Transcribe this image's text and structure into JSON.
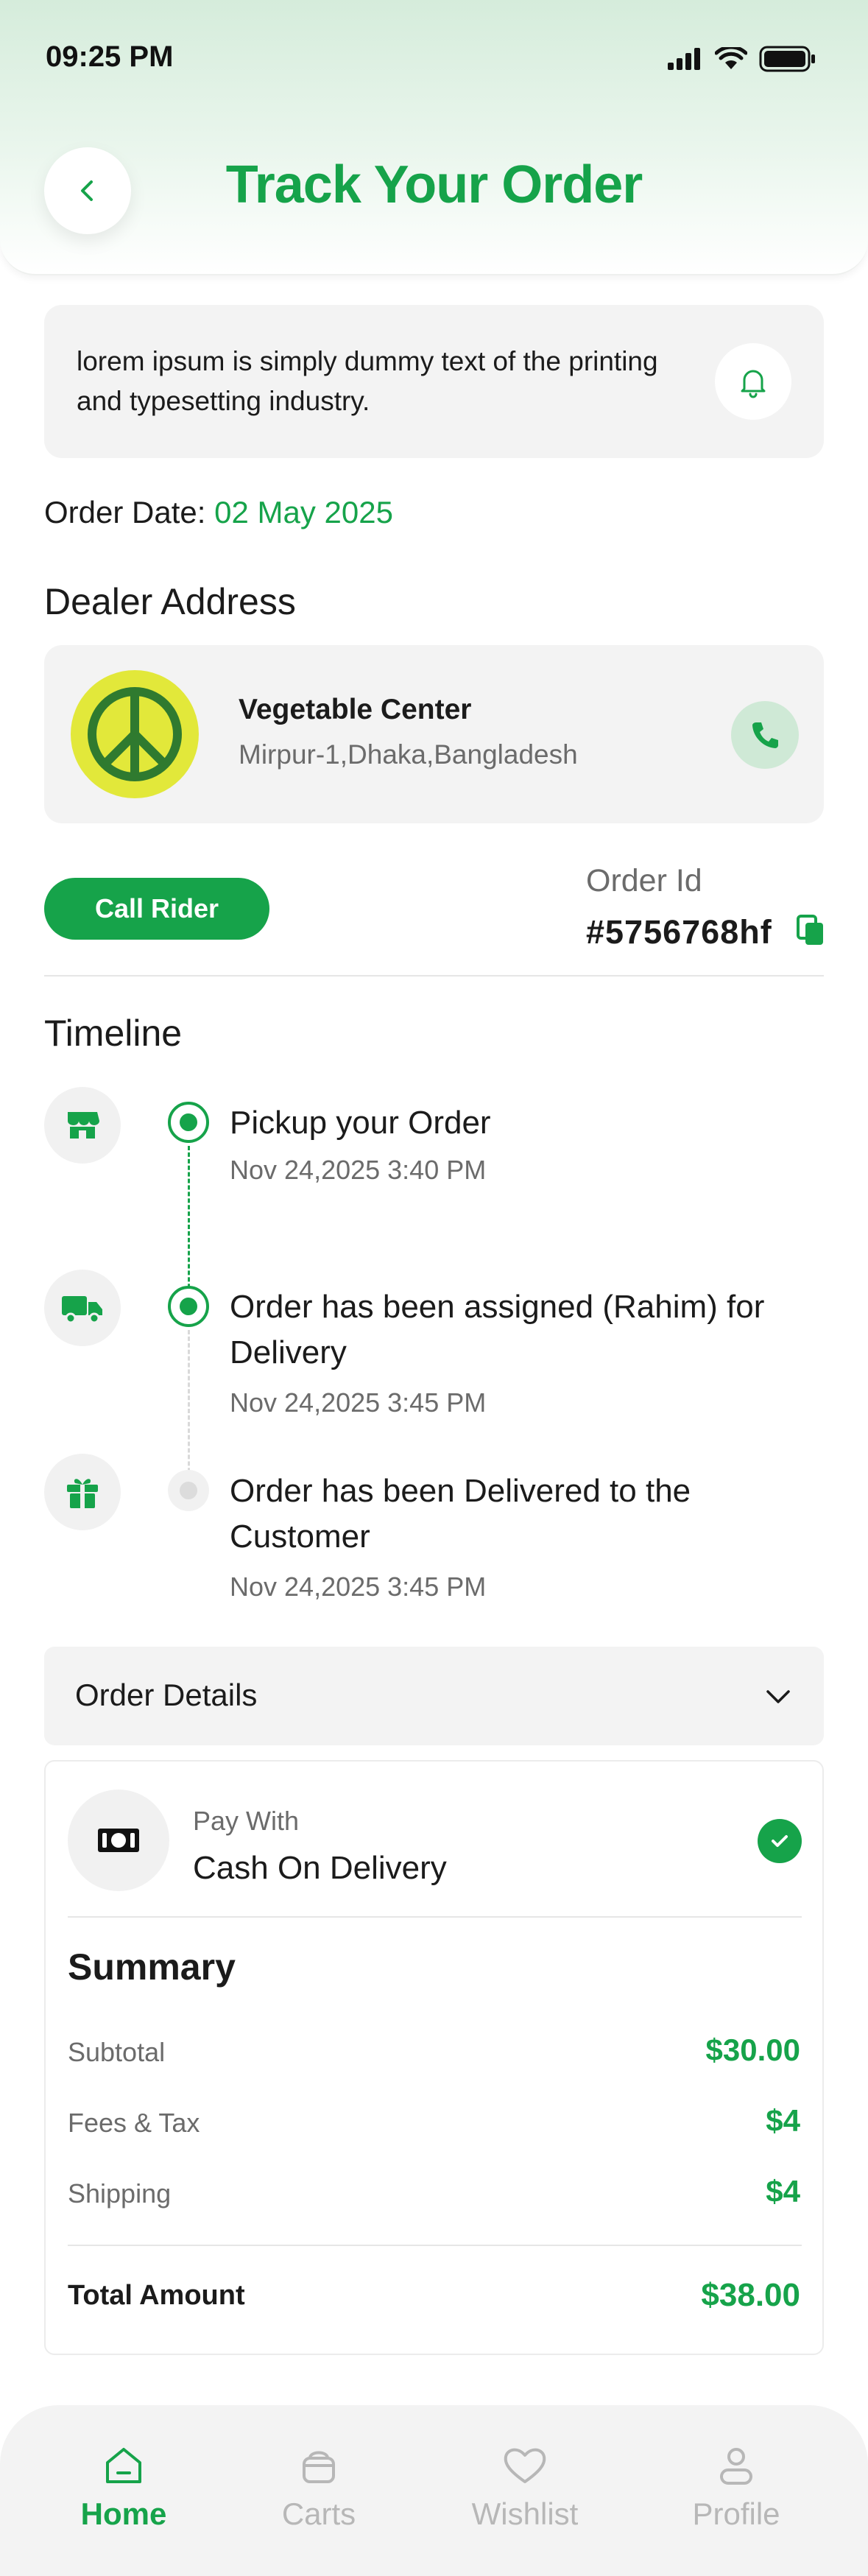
{
  "status_bar": {
    "time": "09:25 PM"
  },
  "header": {
    "title": "Track Your Order"
  },
  "notice": {
    "text": "lorem ipsum is simply dummy text of the printing and typesetting industry."
  },
  "order": {
    "date_label": "Order Date:",
    "date_value": "02 May 2025",
    "id_label": "Order Id",
    "id_value": "#5756768hf",
    "call_rider_label": "Call Rider"
  },
  "dealer": {
    "section_title": "Dealer Address",
    "name": "Vegetable Center",
    "address": "Mirpur-1,Dhaka,Bangladesh"
  },
  "timeline": {
    "section_title": "Timeline",
    "events": [
      {
        "icon": "store-icon",
        "title": "Pickup your Order",
        "time": "Nov 24,2025 3:40 PM",
        "status": "done"
      },
      {
        "icon": "truck-icon",
        "title": "Order has been assigned (Rahim) for Delivery",
        "time": "Nov 24,2025 3:45 PM",
        "status": "done"
      },
      {
        "icon": "gift-icon",
        "title": "Order has been Delivered to the Customer",
        "time": "Nov 24,2025 3:45 PM",
        "status": "pending"
      }
    ]
  },
  "order_details": {
    "label": "Order Details",
    "pay_with_label": "Pay With",
    "pay_with_value": "Cash On Delivery",
    "summary_title": "Summary",
    "rows": [
      {
        "label": "Subtotal",
        "value": "$30.00"
      },
      {
        "label": "Fees & Tax",
        "value": "$4"
      },
      {
        "label": "Shipping",
        "value": "$4"
      }
    ],
    "total_label": "Total Amount",
    "total_value": "$38.00"
  },
  "bottom_nav": {
    "items": [
      {
        "label": "Home",
        "icon": "home-icon",
        "active": true
      },
      {
        "label": "Carts",
        "icon": "cart-icon",
        "active": false
      },
      {
        "label": "Wishlist",
        "icon": "heart-icon",
        "active": false
      },
      {
        "label": "Profile",
        "icon": "profile-icon",
        "active": false
      }
    ]
  },
  "colors": {
    "accent": "#16a34a",
    "card_bg": "#f3f3f3",
    "muted_text": "#6b6b6b",
    "inactive_nav": "#b7b7b7"
  }
}
